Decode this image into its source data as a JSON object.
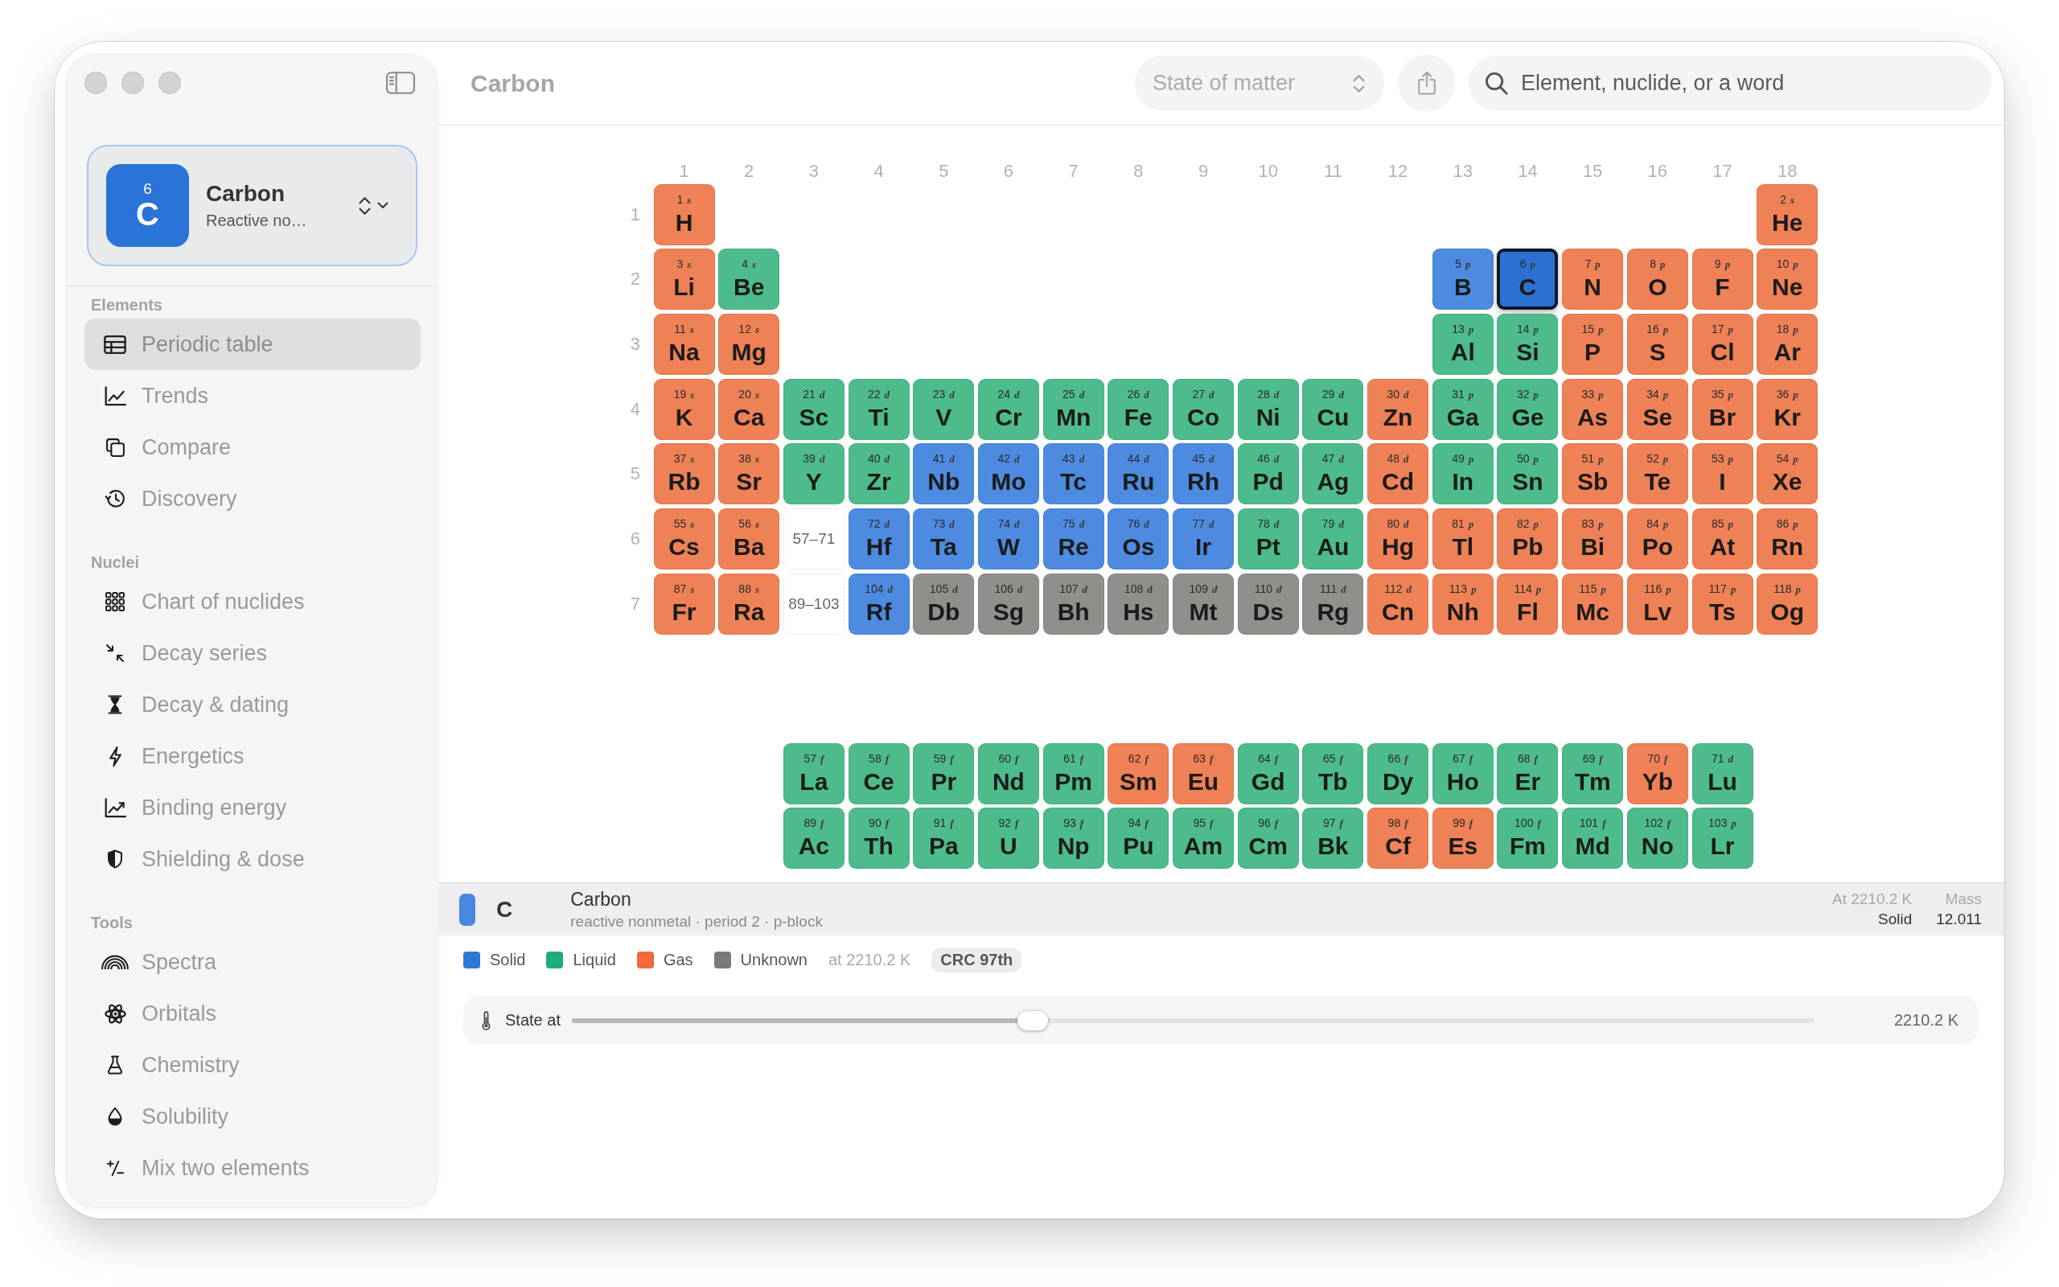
{
  "sidebar": {
    "picker": {
      "number": "6",
      "symbol": "C",
      "name": "Carbon",
      "subtitle": "Reactive no…"
    },
    "sections": [
      {
        "title": "Elements",
        "items": [
          {
            "label": "Periodic table",
            "selected": true
          },
          {
            "label": "Trends",
            "selected": false
          },
          {
            "label": "Compare",
            "selected": false
          },
          {
            "label": "Discovery",
            "selected": false
          }
        ]
      },
      {
        "title": "Nuclei",
        "items": [
          {
            "label": "Chart of nuclides",
            "selected": false
          },
          {
            "label": "Decay series",
            "selected": false
          },
          {
            "label": "Decay & dating",
            "selected": false
          },
          {
            "label": "Energetics",
            "selected": false
          },
          {
            "label": "Binding energy",
            "selected": false
          },
          {
            "label": "Shielding & dose",
            "selected": false
          }
        ]
      },
      {
        "title": "Tools",
        "items": [
          {
            "label": "Spectra",
            "selected": false
          },
          {
            "label": "Orbitals",
            "selected": false
          },
          {
            "label": "Chemistry",
            "selected": false
          },
          {
            "label": "Solubility",
            "selected": false
          },
          {
            "label": "Mix two elements",
            "selected": false
          }
        ]
      }
    ]
  },
  "toolbar": {
    "title": "Carbon",
    "state_popup": {
      "label": "State of matter"
    },
    "search": {
      "placeholder": "Element, nuclide, or a word"
    }
  },
  "table": {
    "groups": [
      "1",
      "2",
      "3",
      "4",
      "5",
      "6",
      "7",
      "8",
      "9",
      "10",
      "11",
      "12",
      "13",
      "14",
      "15",
      "16",
      "17",
      "18"
    ],
    "periods": [
      {
        "label": "1",
        "cells": [
          {
            "kind": "element",
            "number": "1",
            "block": "s",
            "symbol": "H",
            "color": "#ef8156",
            "selected": false
          },
          {
            "kind": "element",
            "number": "2",
            "block": "s",
            "symbol": "He",
            "color": "#ef8156",
            "selected": false
          }
        ]
      },
      {
        "label": "2",
        "cells": [
          {
            "kind": "element",
            "number": "3",
            "block": "s",
            "symbol": "Li",
            "color": "#ef8156",
            "selected": false
          },
          {
            "kind": "element",
            "number": "4",
            "block": "s",
            "symbol": "Be",
            "color": "#4dbb8b",
            "selected": false
          },
          {
            "kind": "element",
            "number": "5",
            "block": "p",
            "symbol": "B",
            "color": "#4d8be0",
            "selected": false
          },
          {
            "kind": "element",
            "number": "6",
            "block": "p",
            "symbol": "C",
            "color": "#2c71d2",
            "selected": true
          },
          {
            "kind": "element",
            "number": "7",
            "block": "p",
            "symbol": "N",
            "color": "#ef8156",
            "selected": false
          },
          {
            "kind": "element",
            "number": "8",
            "block": "p",
            "symbol": "O",
            "color": "#ef8156",
            "selected": false
          },
          {
            "kind": "element",
            "number": "9",
            "block": "p",
            "symbol": "F",
            "color": "#ef8156",
            "selected": false
          },
          {
            "kind": "element",
            "number": "10",
            "block": "p",
            "symbol": "Ne",
            "color": "#ef8156",
            "selected": false
          }
        ]
      },
      {
        "label": "3",
        "cells": [
          {
            "kind": "element",
            "number": "11",
            "block": "s",
            "symbol": "Na",
            "color": "#ef8156",
            "selected": false
          },
          {
            "kind": "element",
            "number": "12",
            "block": "s",
            "symbol": "Mg",
            "color": "#ef8156",
            "selected": false
          },
          {
            "kind": "element",
            "number": "13",
            "block": "p",
            "symbol": "Al",
            "color": "#4dbb8b",
            "selected": false
          },
          {
            "kind": "element",
            "number": "14",
            "block": "p",
            "symbol": "Si",
            "color": "#4dbb8b",
            "selected": false
          },
          {
            "kind": "element",
            "number": "15",
            "block": "p",
            "symbol": "P",
            "color": "#ef8156",
            "selected": false
          },
          {
            "kind": "element",
            "number": "16",
            "block": "p",
            "symbol": "S",
            "color": "#ef8156",
            "selected": false
          },
          {
            "kind": "element",
            "number": "17",
            "block": "p",
            "symbol": "Cl",
            "color": "#ef8156",
            "selected": false
          },
          {
            "kind": "element",
            "number": "18",
            "block": "p",
            "symbol": "Ar",
            "color": "#ef8156",
            "selected": false
          }
        ]
      },
      {
        "label": "4",
        "cells": [
          {
            "kind": "element",
            "number": "19",
            "block": "s",
            "symbol": "K",
            "color": "#ef8156",
            "selected": false
          },
          {
            "kind": "element",
            "number": "20",
            "block": "s",
            "symbol": "Ca",
            "color": "#ef8156",
            "selected": false
          },
          {
            "kind": "element",
            "number": "21",
            "block": "d",
            "symbol": "Sc",
            "color": "#4dbb8b",
            "selected": false
          },
          {
            "kind": "element",
            "number": "22",
            "block": "d",
            "symbol": "Ti",
            "color": "#4dbb8b",
            "selected": false
          },
          {
            "kind": "element",
            "number": "23",
            "block": "d",
            "symbol": "V",
            "color": "#4dbb8b",
            "selected": false
          },
          {
            "kind": "element",
            "number": "24",
            "block": "d",
            "symbol": "Cr",
            "color": "#4dbb8b",
            "selected": false
          },
          {
            "kind": "element",
            "number": "25",
            "block": "d",
            "symbol": "Mn",
            "color": "#4dbb8b",
            "selected": false
          },
          {
            "kind": "element",
            "number": "26",
            "block": "d",
            "symbol": "Fe",
            "color": "#4dbb8b",
            "selected": false
          },
          {
            "kind": "element",
            "number": "27",
            "block": "d",
            "symbol": "Co",
            "color": "#4dbb8b",
            "selected": false
          },
          {
            "kind": "element",
            "number": "28",
            "block": "d",
            "symbol": "Ni",
            "color": "#4dbb8b",
            "selected": false
          },
          {
            "kind": "element",
            "number": "29",
            "block": "d",
            "symbol": "Cu",
            "color": "#4dbb8b",
            "selected": false
          },
          {
            "kind": "element",
            "number": "30",
            "block": "d",
            "symbol": "Zn",
            "color": "#ef8156",
            "selected": false
          },
          {
            "kind": "element",
            "number": "31",
            "block": "p",
            "symbol": "Ga",
            "color": "#4dbb8b",
            "selected": false
          },
          {
            "kind": "element",
            "number": "32",
            "block": "p",
            "symbol": "Ge",
            "color": "#4dbb8b",
            "selected": false
          },
          {
            "kind": "element",
            "number": "33",
            "block": "p",
            "symbol": "As",
            "color": "#ef8156",
            "selected": false
          },
          {
            "kind": "element",
            "number": "34",
            "block": "p",
            "symbol": "Se",
            "color": "#ef8156",
            "selected": false
          },
          {
            "kind": "element",
            "number": "35",
            "block": "p",
            "symbol": "Br",
            "color": "#ef8156",
            "selected": false
          },
          {
            "kind": "element",
            "number": "36",
            "block": "p",
            "symbol": "Kr",
            "color": "#ef8156",
            "selected": false
          }
        ]
      },
      {
        "label": "5",
        "cells": [
          {
            "kind": "element",
            "number": "37",
            "block": "s",
            "symbol": "Rb",
            "color": "#ef8156",
            "selected": false
          },
          {
            "kind": "element",
            "number": "38",
            "block": "s",
            "symbol": "Sr",
            "color": "#ef8156",
            "selected": false
          },
          {
            "kind": "element",
            "number": "39",
            "block": "d",
            "symbol": "Y",
            "color": "#4dbb8b",
            "selected": false
          },
          {
            "kind": "element",
            "number": "40",
            "block": "d",
            "symbol": "Zr",
            "color": "#4dbb8b",
            "selected": false
          },
          {
            "kind": "element",
            "number": "41",
            "block": "d",
            "symbol": "Nb",
            "color": "#4d8be0",
            "selected": false
          },
          {
            "kind": "element",
            "number": "42",
            "block": "d",
            "symbol": "Mo",
            "color": "#4d8be0",
            "selected": false
          },
          {
            "kind": "element",
            "number": "43",
            "block": "d",
            "symbol": "Tc",
            "color": "#4d8be0",
            "selected": false
          },
          {
            "kind": "element",
            "number": "44",
            "block": "d",
            "symbol": "Ru",
            "color": "#4d8be0",
            "selected": false
          },
          {
            "kind": "element",
            "number": "45",
            "block": "d",
            "symbol": "Rh",
            "color": "#4d8be0",
            "selected": false
          },
          {
            "kind": "element",
            "number": "46",
            "block": "d",
            "symbol": "Pd",
            "color": "#4dbb8b",
            "selected": false
          },
          {
            "kind": "element",
            "number": "47",
            "block": "d",
            "symbol": "Ag",
            "color": "#4dbb8b",
            "selected": false
          },
          {
            "kind": "element",
            "number": "48",
            "block": "d",
            "symbol": "Cd",
            "color": "#ef8156",
            "selected": false
          },
          {
            "kind": "element",
            "number": "49",
            "block": "p",
            "symbol": "In",
            "color": "#4dbb8b",
            "selected": false
          },
          {
            "kind": "element",
            "number": "50",
            "block": "p",
            "symbol": "Sn",
            "color": "#4dbb8b",
            "selected": false
          },
          {
            "kind": "element",
            "number": "51",
            "block": "p",
            "symbol": "Sb",
            "color": "#ef8156",
            "selected": false
          },
          {
            "kind": "element",
            "number": "52",
            "block": "p",
            "symbol": "Te",
            "color": "#ef8156",
            "selected": false
          },
          {
            "kind": "element",
            "number": "53",
            "block": "p",
            "symbol": "I",
            "color": "#ef8156",
            "selected": false
          },
          {
            "kind": "element",
            "number": "54",
            "block": "p",
            "symbol": "Xe",
            "color": "#ef8156",
            "selected": false
          }
        ]
      },
      {
        "label": "6",
        "cells": [
          {
            "kind": "element",
            "number": "55",
            "block": "s",
            "symbol": "Cs",
            "color": "#ef8156",
            "selected": false
          },
          {
            "kind": "element",
            "number": "56",
            "block": "s",
            "symbol": "Ba",
            "color": "#ef8156",
            "selected": false
          },
          {
            "kind": "range",
            "label": "57–71"
          },
          {
            "kind": "element",
            "number": "72",
            "block": "d",
            "symbol": "Hf",
            "color": "#4d8be0",
            "selected": false
          },
          {
            "kind": "element",
            "number": "73",
            "block": "d",
            "symbol": "Ta",
            "color": "#4d8be0",
            "selected": false
          },
          {
            "kind": "element",
            "number": "74",
            "block": "d",
            "symbol": "W",
            "color": "#4d8be0",
            "selected": false
          },
          {
            "kind": "element",
            "number": "75",
            "block": "d",
            "symbol": "Re",
            "color": "#4d8be0",
            "selected": false
          },
          {
            "kind": "element",
            "number": "76",
            "block": "d",
            "symbol": "Os",
            "color": "#4d8be0",
            "selected": false
          },
          {
            "kind": "element",
            "number": "77",
            "block": "d",
            "symbol": "Ir",
            "color": "#4d8be0",
            "selected": false
          },
          {
            "kind": "element",
            "number": "78",
            "block": "d",
            "symbol": "Pt",
            "color": "#4dbb8b",
            "selected": false
          },
          {
            "kind": "element",
            "number": "79",
            "block": "d",
            "symbol": "Au",
            "color": "#4dbb8b",
            "selected": false
          },
          {
            "kind": "element",
            "number": "80",
            "block": "d",
            "symbol": "Hg",
            "color": "#ef8156",
            "selected": false
          },
          {
            "kind": "element",
            "number": "81",
            "block": "p",
            "symbol": "Tl",
            "color": "#ef8156",
            "selected": false
          },
          {
            "kind": "element",
            "number": "82",
            "block": "p",
            "symbol": "Pb",
            "color": "#ef8156",
            "selected": false
          },
          {
            "kind": "element",
            "number": "83",
            "block": "p",
            "symbol": "Bi",
            "color": "#ef8156",
            "selected": false
          },
          {
            "kind": "element",
            "number": "84",
            "block": "p",
            "symbol": "Po",
            "color": "#ef8156",
            "selected": false
          },
          {
            "kind": "element",
            "number": "85",
            "block": "p",
            "symbol": "At",
            "color": "#ef8156",
            "selected": false
          },
          {
            "kind": "element",
            "number": "86",
            "block": "p",
            "symbol": "Rn",
            "color": "#ef8156",
            "selected": false
          }
        ]
      },
      {
        "label": "7",
        "cells": [
          {
            "kind": "element",
            "number": "87",
            "block": "s",
            "symbol": "Fr",
            "color": "#ef8156",
            "selected": false
          },
          {
            "kind": "element",
            "number": "88",
            "block": "s",
            "symbol": "Ra",
            "color": "#ef8156",
            "selected": false
          },
          {
            "kind": "range",
            "label": "89–103"
          },
          {
            "kind": "element",
            "number": "104",
            "block": "d",
            "symbol": "Rf",
            "color": "#4d8be0",
            "selected": false
          },
          {
            "kind": "element",
            "number": "105",
            "block": "d",
            "symbol": "Db",
            "color": "#8f8f8b",
            "selected": false
          },
          {
            "kind": "element",
            "number": "106",
            "block": "d",
            "symbol": "Sg",
            "color": "#8f8f8b",
            "selected": false
          },
          {
            "kind": "element",
            "number": "107",
            "block": "d",
            "symbol": "Bh",
            "color": "#8f8f8b",
            "selected": false
          },
          {
            "kind": "element",
            "number": "108",
            "block": "d",
            "symbol": "Hs",
            "color": "#8f8f8b",
            "selected": false
          },
          {
            "kind": "element",
            "number": "109",
            "block": "d",
            "symbol": "Mt",
            "color": "#8f8f8b",
            "selected": false
          },
          {
            "kind": "element",
            "number": "110",
            "block": "d",
            "symbol": "Ds",
            "color": "#8f8f8b",
            "selected": false
          },
          {
            "kind": "element",
            "number": "111",
            "block": "d",
            "symbol": "Rg",
            "color": "#8f8f8b",
            "selected": false
          },
          {
            "kind": "element",
            "number": "112",
            "block": "d",
            "symbol": "Cn",
            "color": "#ef8156",
            "selected": false
          },
          {
            "kind": "element",
            "number": "113",
            "block": "p",
            "symbol": "Nh",
            "color": "#ef8156",
            "selected": false
          },
          {
            "kind": "element",
            "number": "114",
            "block": "p",
            "symbol": "Fl",
            "color": "#ef8156",
            "selected": false
          },
          {
            "kind": "element",
            "number": "115",
            "block": "p",
            "symbol": "Mc",
            "color": "#ef8156",
            "selected": false
          },
          {
            "kind": "element",
            "number": "116",
            "block": "p",
            "symbol": "Lv",
            "color": "#ef8156",
            "selected": false
          },
          {
            "kind": "element",
            "number": "117",
            "block": "p",
            "symbol": "Ts",
            "color": "#ef8156",
            "selected": false
          },
          {
            "kind": "element",
            "number": "118",
            "block": "p",
            "symbol": "Og",
            "color": "#ef8156",
            "selected": false
          }
        ]
      }
    ],
    "f_block": [
      {
        "cells": [
          {
            "kind": "element",
            "number": "57",
            "block": "f",
            "symbol": "La",
            "color": "#4dbb8b",
            "selected": false
          },
          {
            "kind": "element",
            "number": "58",
            "block": "f",
            "symbol": "Ce",
            "color": "#4dbb8b",
            "selected": false
          },
          {
            "kind": "element",
            "number": "59",
            "block": "f",
            "symbol": "Pr",
            "color": "#4dbb8b",
            "selected": false
          },
          {
            "kind": "element",
            "number": "60",
            "block": "f",
            "symbol": "Nd",
            "color": "#4dbb8b",
            "selected": false
          },
          {
            "kind": "element",
            "number": "61",
            "block": "f",
            "symbol": "Pm",
            "color": "#4dbb8b",
            "selected": false
          },
          {
            "kind": "element",
            "number": "62",
            "block": "f",
            "symbol": "Sm",
            "color": "#ef8156",
            "selected": false
          },
          {
            "kind": "element",
            "number": "63",
            "block": "f",
            "symbol": "Eu",
            "color": "#ef8156",
            "selected": false
          },
          {
            "kind": "element",
            "number": "64",
            "block": "f",
            "symbol": "Gd",
            "color": "#4dbb8b",
            "selected": false
          },
          {
            "kind": "element",
            "number": "65",
            "block": "f",
            "symbol": "Tb",
            "color": "#4dbb8b",
            "selected": false
          },
          {
            "kind": "element",
            "number": "66",
            "block": "f",
            "symbol": "Dy",
            "color": "#4dbb8b",
            "selected": false
          },
          {
            "kind": "element",
            "number": "67",
            "block": "f",
            "symbol": "Ho",
            "color": "#4dbb8b",
            "selected": false
          },
          {
            "kind": "element",
            "number": "68",
            "block": "f",
            "symbol": "Er",
            "color": "#4dbb8b",
            "selected": false
          },
          {
            "kind": "element",
            "number": "69",
            "block": "f",
            "symbol": "Tm",
            "color": "#4dbb8b",
            "selected": false
          },
          {
            "kind": "element",
            "number": "70",
            "block": "f",
            "symbol": "Yb",
            "color": "#ef8156",
            "selected": false
          },
          {
            "kind": "element",
            "number": "71",
            "block": "d",
            "symbol": "Lu",
            "color": "#4dbb8b",
            "selected": false
          }
        ]
      },
      {
        "cells": [
          {
            "kind": "element",
            "number": "89",
            "block": "f",
            "symbol": "Ac",
            "color": "#4dbb8b",
            "selected": false
          },
          {
            "kind": "element",
            "number": "90",
            "block": "f",
            "symbol": "Th",
            "color": "#4dbb8b",
            "selected": false
          },
          {
            "kind": "element",
            "number": "91",
            "block": "f",
            "symbol": "Pa",
            "color": "#4dbb8b",
            "selected": false
          },
          {
            "kind": "element",
            "number": "92",
            "block": "f",
            "symbol": "U",
            "color": "#4dbb8b",
            "selected": false
          },
          {
            "kind": "element",
            "number": "93",
            "block": "f",
            "symbol": "Np",
            "color": "#4dbb8b",
            "selected": false
          },
          {
            "kind": "element",
            "number": "94",
            "block": "f",
            "symbol": "Pu",
            "color": "#4dbb8b",
            "selected": false
          },
          {
            "kind": "element",
            "number": "95",
            "block": "f",
            "symbol": "Am",
            "color": "#4dbb8b",
            "selected": false
          },
          {
            "kind": "element",
            "number": "96",
            "block": "f",
            "symbol": "Cm",
            "color": "#4dbb8b",
            "selected": false
          },
          {
            "kind": "element",
            "number": "97",
            "block": "f",
            "symbol": "Bk",
            "color": "#4dbb8b",
            "selected": false
          },
          {
            "kind": "element",
            "number": "98",
            "block": "f",
            "symbol": "Cf",
            "color": "#ef8156",
            "selected": false
          },
          {
            "kind": "element",
            "number": "99",
            "block": "f",
            "symbol": "Es",
            "color": "#ef8156",
            "selected": false
          },
          {
            "kind": "element",
            "number": "100",
            "block": "f",
            "symbol": "Fm",
            "color": "#4dbb8b",
            "selected": false
          },
          {
            "kind": "element",
            "number": "101",
            "block": "f",
            "symbol": "Md",
            "color": "#4dbb8b",
            "selected": false
          },
          {
            "kind": "element",
            "number": "102",
            "block": "f",
            "symbol": "No",
            "color": "#4dbb8b",
            "selected": false
          },
          {
            "kind": "element",
            "number": "103",
            "block": "p",
            "symbol": "Lr",
            "color": "#4dbb8b",
            "selected": false
          }
        ]
      }
    ]
  },
  "info_bar": {
    "color": "#4a87e1",
    "symbol": "C",
    "name": "Carbon",
    "description": "reactive nonmetal · period 2 · p-block",
    "temperature": "At 2210.2 K",
    "state_label": "Solid",
    "mass_label": "Mass",
    "mass": "12.011"
  },
  "legend": {
    "items": [
      {
        "label": "Solid",
        "color": "#2f78d8"
      },
      {
        "label": "Liquid",
        "color": "#1fae7a"
      },
      {
        "label": "Gas",
        "color": "#ee6a3a"
      },
      {
        "label": "Unknown",
        "color": "#7a7a7a"
      }
    ],
    "temperature": "at 2210.2 K",
    "source": "CRC 97th"
  },
  "slider": {
    "label": "State at",
    "level": 0.371,
    "reading": "2210.2 K"
  }
}
